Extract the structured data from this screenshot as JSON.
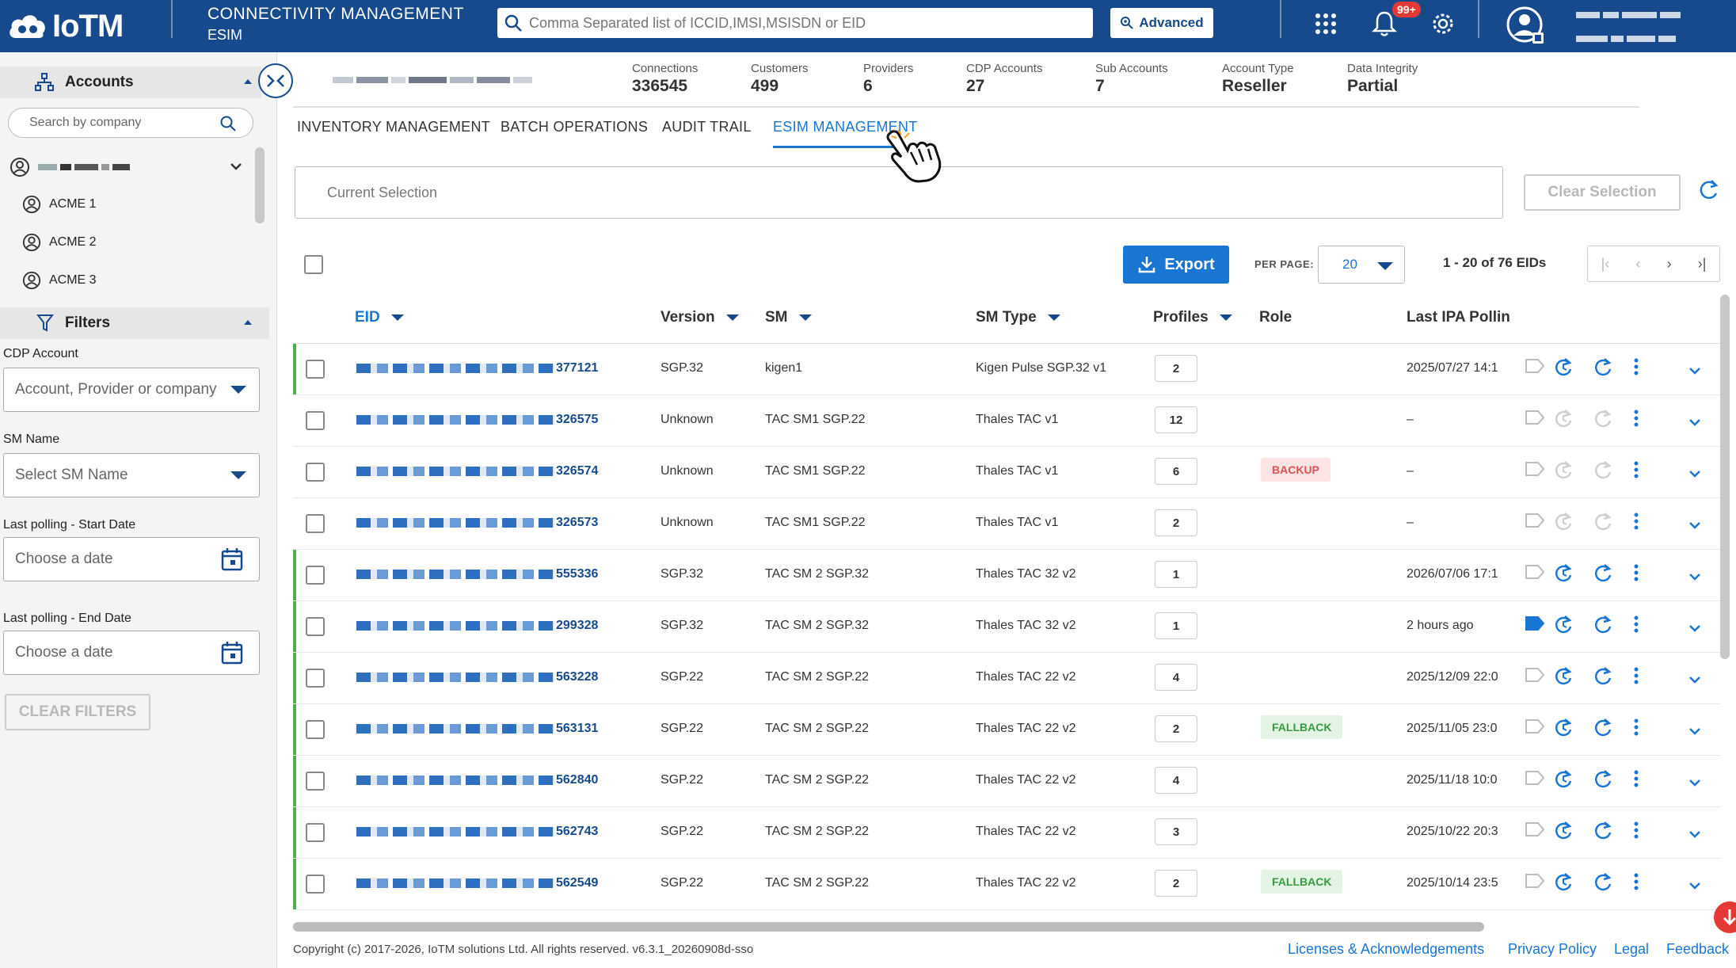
{
  "brand": {
    "logo_text": "IoTM"
  },
  "header": {
    "title": "CONNECTIVITY MANAGEMENT",
    "subtitle": "ESIM",
    "search_placeholder": "Comma Separated list of ICCID,IMSI,MSISDN or EID",
    "advanced_label": "Advanced",
    "notifications_badge": "99+",
    "icons": [
      "search-icon",
      "apps-grid-icon",
      "bell-icon",
      "gear-icon",
      "user-avatar-icon"
    ]
  },
  "sidebar": {
    "accounts_label": "Accounts",
    "search_placeholder": "Search by company",
    "accounts": [
      "ACME 1",
      "ACME 2",
      "ACME 3"
    ],
    "filters_label": "Filters",
    "filters": {
      "cdp_account_label": "CDP Account",
      "cdp_account_placeholder": "Account, Provider or company",
      "sm_name_label": "SM Name",
      "sm_name_placeholder": "Select SM Name",
      "start_date_label": "Last polling - Start Date",
      "start_date_placeholder": "Choose a date",
      "end_date_label": "Last polling - End Date",
      "end_date_placeholder": "Choose a date",
      "clear_label": "CLEAR FILTERS"
    }
  },
  "stats": [
    {
      "label": "Connections",
      "value": "336545"
    },
    {
      "label": "Customers",
      "value": "499"
    },
    {
      "label": "Providers",
      "value": "6"
    },
    {
      "label": "CDP Accounts",
      "value": "27"
    },
    {
      "label": "Sub Accounts",
      "value": "7"
    },
    {
      "label": "Account Type",
      "value": "Reseller"
    },
    {
      "label": "Data Integrity",
      "value": "Partial"
    }
  ],
  "tabs": [
    "INVENTORY MANAGEMENT",
    "BATCH OPERATIONS",
    "AUDIT TRAIL",
    "ESIM MANAGEMENT"
  ],
  "active_tab": "ESIM MANAGEMENT",
  "selection": {
    "placeholder": "Current Selection",
    "clear_label": "Clear Selection"
  },
  "toolbar": {
    "export_label": "Export",
    "per_page_label": "PER PAGE:",
    "per_page_value": "20",
    "range_text": "1 - 20 of 76 EIDs"
  },
  "table": {
    "columns": [
      "EID",
      "Version",
      "SM",
      "SM Type",
      "Profiles",
      "Role",
      "Last IPA Pollin"
    ],
    "rows": [
      {
        "eid": "377121",
        "version": "SGP.32",
        "sm": "kigen1",
        "sm_type": "Kigen Pulse SGP.32 v1",
        "profiles": "2",
        "role": "",
        "last_poll": "2025/07/27 14:1",
        "status": "active"
      },
      {
        "eid": "326575",
        "version": "Unknown",
        "sm": "TAC SM1 SGP.22",
        "sm_type": "Thales TAC v1",
        "profiles": "12",
        "role": "",
        "last_poll": "–",
        "status": "disabled"
      },
      {
        "eid": "326574",
        "version": "Unknown",
        "sm": "TAC SM1 SGP.22",
        "sm_type": "Thales TAC v1",
        "profiles": "6",
        "role": "BACKUP",
        "last_poll": "–",
        "status": "disabled"
      },
      {
        "eid": "326573",
        "version": "Unknown",
        "sm": "TAC SM1 SGP.22",
        "sm_type": "Thales TAC v1",
        "profiles": "2",
        "role": "",
        "last_poll": "–",
        "status": "disabled"
      },
      {
        "eid": "555336",
        "version": "SGP.32",
        "sm": "TAC SM 2 SGP.32",
        "sm_type": "Thales TAC 32 v2",
        "profiles": "1",
        "role": "",
        "last_poll": "2026/07/06 17:1",
        "status": "active"
      },
      {
        "eid": "299328",
        "version": "SGP.32",
        "sm": "TAC SM 2 SGP.32",
        "sm_type": "Thales TAC 32 v2",
        "profiles": "1",
        "role": "",
        "last_poll": "2 hours ago",
        "status": "tagged"
      },
      {
        "eid": "563228",
        "version": "SGP.22",
        "sm": "TAC SM 2 SGP.22",
        "sm_type": "Thales TAC 22 v2",
        "profiles": "4",
        "role": "",
        "last_poll": "2025/12/09 22:0",
        "status": "active"
      },
      {
        "eid": "563131",
        "version": "SGP.22",
        "sm": "TAC SM 2 SGP.22",
        "sm_type": "Thales TAC 22 v2",
        "profiles": "2",
        "role": "FALLBACK",
        "last_poll": "2025/11/05 23:0",
        "status": "active"
      },
      {
        "eid": "562840",
        "version": "SGP.22",
        "sm": "TAC SM 2 SGP.22",
        "sm_type": "Thales TAC 22 v2",
        "profiles": "4",
        "role": "",
        "last_poll": "2025/11/18 10:0",
        "status": "active"
      },
      {
        "eid": "562743",
        "version": "SGP.22",
        "sm": "TAC SM 2 SGP.22",
        "sm_type": "Thales TAC 22 v2",
        "profiles": "3",
        "role": "",
        "last_poll": "2025/10/22 20:3",
        "status": "active"
      },
      {
        "eid": "562549",
        "version": "SGP.22",
        "sm": "TAC SM 2 SGP.22",
        "sm_type": "Thales TAC 22 v2",
        "profiles": "2",
        "role": "FALLBACK",
        "last_poll": "2025/10/14 23:5",
        "status": "active"
      }
    ]
  },
  "footer": {
    "copyright": "Copyright (c) 2017-2026, IoTM solutions Ltd. All rights reserved. v6.3.1_20260908d-sso",
    "links": [
      "Licenses & Acknowledgements",
      "Privacy Policy",
      "Legal",
      "Feedback"
    ]
  },
  "colors": {
    "header_bg": "#174a8c",
    "accent": "#1976d2",
    "row_marker": "#4caf50",
    "backup": "#d9534f",
    "fallback": "#3a9a41"
  }
}
